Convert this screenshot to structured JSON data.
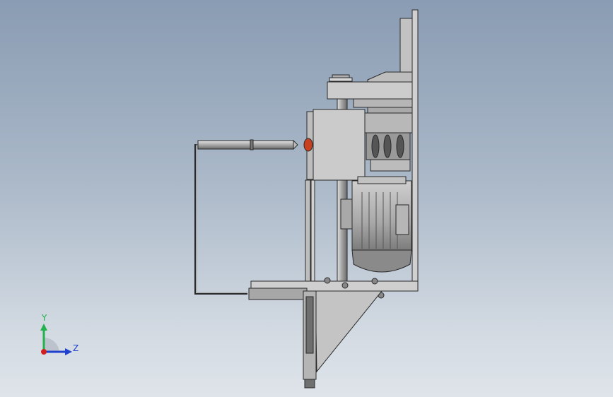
{
  "viewport": {
    "background_top": "#8a9cb3",
    "background_bottom": "#dfe4ea"
  },
  "model": {
    "part_fill": "#c7c7c7",
    "part_stroke": "#2a2a2a",
    "dark_part": "#6f6f6f",
    "indicator_color": "#c84020"
  },
  "triad": {
    "y_label": "Y",
    "z_label": "Z",
    "y_color": "#22b14c",
    "z_color": "#2040d0",
    "x_color": "#d02020"
  }
}
